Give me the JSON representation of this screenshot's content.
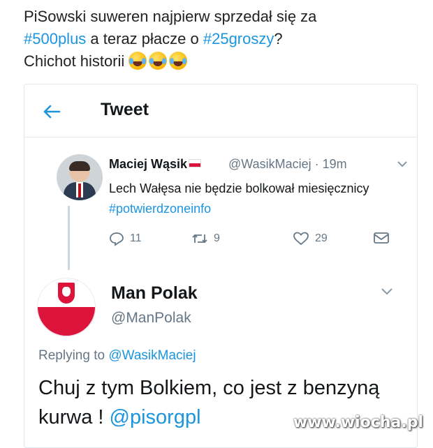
{
  "caption": {
    "line1_text": "PiSowski suweren najpierw sprzedał się za",
    "hashtag1": "#500plus",
    "line2_mid": " a teraz płacze o ",
    "hashtag2": "#25groszy",
    "line2_end": "?",
    "line3_text": "Chichot historii",
    "emoji_name": "face-with-tears-of-joy"
  },
  "header": {
    "title": "Tweet",
    "back_icon": "arrow-left-icon"
  },
  "tweet1": {
    "name": "Maciej Wąsik",
    "handle_time": "@WasikMaciej · 19m",
    "text": "Lech Wałęsa nie będzie bolkował miesięcznicy ",
    "hashtag": "#potwierdzoneinfo",
    "replies": "11",
    "retweets": "9",
    "likes": "29"
  },
  "tweet2": {
    "name": "Man Polak",
    "handle": "@ManPolak",
    "replying_prefix": "Replying to ",
    "replying_to": "@WasikMaciej",
    "text": "Chuj z tym Bolkiem, co jest z benzyną kurwa ! ",
    "mention": "@pisorgpl"
  },
  "watermark": "www.wiocha.pl",
  "colors": {
    "link": "#1b95e0",
    "muted": "#657786",
    "text": "#14171a"
  }
}
